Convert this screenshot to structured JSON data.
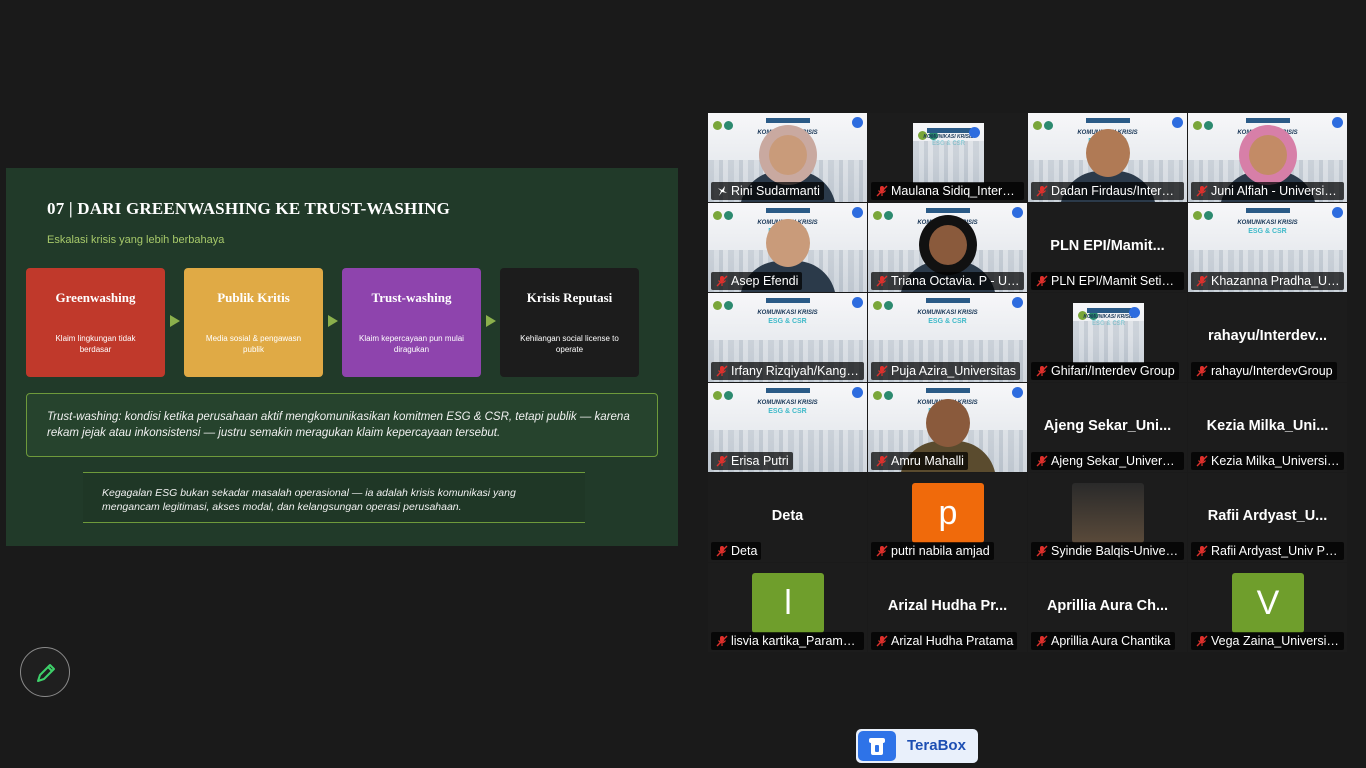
{
  "slide": {
    "title": "07  |  DARI GREENWASHING KE TRUST-WASHING",
    "subtitle": "Eskalasi krisis yang lebih berbahaya",
    "stages": [
      {
        "title": "Greenwashing",
        "desc": "Klaim lingkungan tidak berdasar",
        "color": "#c0392b"
      },
      {
        "title": "Publik Kritis",
        "desc": "Media sosial & pengawasn publik",
        "color": "#e0aa45"
      },
      {
        "title": "Trust-washing",
        "desc": "Klaim kepercayaan pun mulai diragukan",
        "color": "#8e44ad"
      },
      {
        "title": "Krisis Reputasi",
        "desc": "Kehilangan social license to operate",
        "color": "#1c1c1c"
      }
    ],
    "definition": "Trust-washing: kondisi ketika perusahaan aktif mengkomunikasikan komitmen ESG & CSR, tetapi publik — karena rekam jejak atau inkonsistensi — justru semakin meragukan klaim kepercayaan tersebut.",
    "note": "Kegagalan ESG bukan sekadar masalah operasional — ia adalah krisis komunikasi yang mengancam legitimasi, akses modal, dan kelangsungan operasi perusahaan."
  },
  "gallery": {
    "slide_thumb": {
      "kk": "KOMUNIKASI KRISIS",
      "esg": "ESG & CSR"
    },
    "participants": [
      {
        "name": "Rini Sudarmanti",
        "display": "",
        "avatar_letter": "",
        "avatar_color": "",
        "muted": false,
        "type": "video"
      },
      {
        "name": "Maulana Sidiq_Interdev Group",
        "display": "",
        "avatar_letter": "",
        "avatar_color": "",
        "muted": true,
        "type": "mini-slide"
      },
      {
        "name": "Dadan Firdaus/Interdev Group",
        "display": "",
        "avatar_letter": "",
        "avatar_color": "",
        "muted": true,
        "type": "video"
      },
      {
        "name": "Juni Alfiah - Universitas",
        "display": "",
        "avatar_letter": "",
        "avatar_color": "",
        "muted": true,
        "type": "video"
      },
      {
        "name": "Asep Efendi",
        "display": "",
        "avatar_letter": "",
        "avatar_color": "",
        "muted": true,
        "type": "video"
      },
      {
        "name": "Triana Octavia. P - Universitas",
        "display": "",
        "avatar_letter": "",
        "avatar_color": "",
        "muted": true,
        "type": "video"
      },
      {
        "name": "PLN EPI/Mamit Setiawan",
        "display": "PLN  EPI/Mamit...",
        "avatar_letter": "",
        "avatar_color": "",
        "muted": true,
        "type": "name"
      },
      {
        "name": "Khazanna Pradha_Universitas",
        "display": "",
        "avatar_letter": "",
        "avatar_color": "",
        "muted": true,
        "type": "slide"
      },
      {
        "name": "Irfany Rizqiyah/Kangean",
        "display": "",
        "avatar_letter": "",
        "avatar_color": "",
        "muted": true,
        "type": "slide"
      },
      {
        "name": "Puja Azira_Universitas",
        "display": "",
        "avatar_letter": "",
        "avatar_color": "",
        "muted": true,
        "type": "slide"
      },
      {
        "name": "Ghifari/Interdev Group",
        "display": "",
        "avatar_letter": "",
        "avatar_color": "",
        "muted": true,
        "type": "mini-slide"
      },
      {
        "name": "rahayu/InterdevGroup",
        "display": "rahayu/Interdev...",
        "avatar_letter": "",
        "avatar_color": "",
        "muted": true,
        "type": "name"
      },
      {
        "name": "Erisa Putri",
        "display": "",
        "avatar_letter": "",
        "avatar_color": "",
        "muted": true,
        "type": "slide"
      },
      {
        "name": "Amru Mahalli",
        "display": "",
        "avatar_letter": "",
        "avatar_color": "",
        "muted": true,
        "type": "video"
      },
      {
        "name": "Ajeng Sekar_Universitas",
        "display": "Ajeng  Sekar_Uni...",
        "avatar_letter": "",
        "avatar_color": "",
        "muted": true,
        "type": "name"
      },
      {
        "name": "Kezia Milka_Universitas",
        "display": "Kezia  Milka_Uni...",
        "avatar_letter": "",
        "avatar_color": "",
        "muted": true,
        "type": "name"
      },
      {
        "name": "Deta",
        "display": "Deta",
        "avatar_letter": "",
        "avatar_color": "",
        "muted": true,
        "type": "name"
      },
      {
        "name": "putri nabila amjad",
        "display": "",
        "avatar_letter": "p",
        "avatar_color": "#f06a0b",
        "muted": true,
        "type": "avatar"
      },
      {
        "name": "Syindie Balqis-Universitas",
        "display": "",
        "avatar_letter": "",
        "avatar_color": "",
        "muted": true,
        "type": "photo"
      },
      {
        "name": "Rafii Ardyast_Univ Paramadina",
        "display": "Rafii  Ardyast_U...",
        "avatar_letter": "",
        "avatar_color": "",
        "muted": true,
        "type": "name"
      },
      {
        "name": "lisvia kartika_Paramadina",
        "display": "",
        "avatar_letter": "l",
        "avatar_color": "#6f9e2c",
        "muted": true,
        "type": "avatar"
      },
      {
        "name": "Arizal Hudha Pratama",
        "display": "Arizal  Hudha  Pr...",
        "avatar_letter": "",
        "avatar_color": "",
        "muted": true,
        "type": "name"
      },
      {
        "name": "Aprillia Aura Chantika",
        "display": "Aprillia  Aura  Ch...",
        "avatar_letter": "",
        "avatar_color": "",
        "muted": true,
        "type": "name"
      },
      {
        "name": "Vega Zaina_Universitas",
        "display": "",
        "avatar_letter": "V",
        "avatar_color": "#6f9e2c",
        "muted": true,
        "type": "avatar"
      }
    ]
  },
  "controls": {
    "annotate_icon": "pencil-icon",
    "terabox_label": "TeraBox"
  }
}
